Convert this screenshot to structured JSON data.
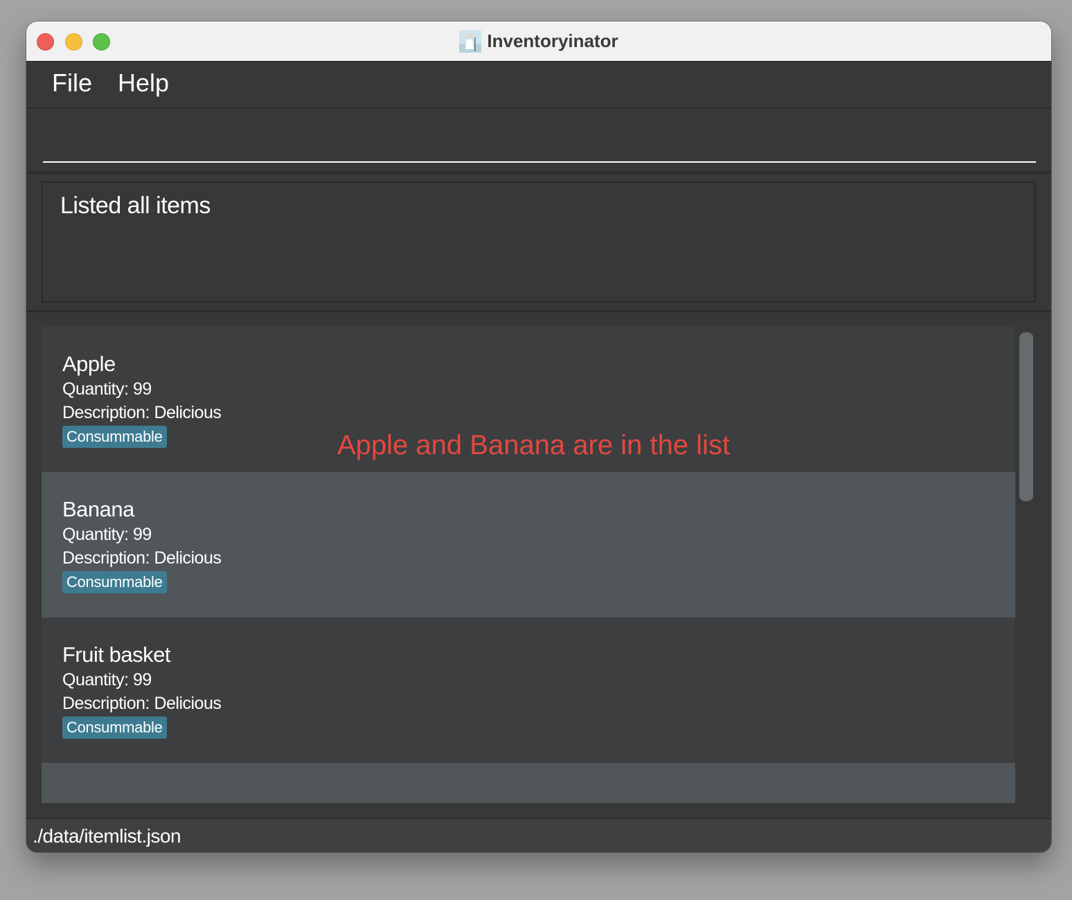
{
  "window": {
    "title": "Inventoryinator"
  },
  "menu": {
    "file": "File",
    "help": "Help"
  },
  "command_box": {
    "value": "",
    "placeholder": ""
  },
  "result_display": {
    "message": "Listed all items"
  },
  "items": [
    {
      "name": "Apple",
      "quantity": "Quantity: 99",
      "description": "Description: Delicious",
      "tag": "Consummable"
    },
    {
      "name": "Banana",
      "quantity": "Quantity: 99",
      "description": "Description: Delicious",
      "tag": "Consummable"
    },
    {
      "name": "Fruit basket",
      "quantity": "Quantity: 99",
      "description": "Description: Delicious",
      "tag": "Consummable"
    }
  ],
  "annotation": {
    "text": "Apple and Banana are in the list",
    "color": "#e3483f"
  },
  "status_bar": {
    "path": "./data/itemlist.json"
  },
  "colors": {
    "tag_background": "#3e7b91",
    "card_odd": "#3c3e40",
    "card_even": "#50565a",
    "window_background": "#383838"
  }
}
